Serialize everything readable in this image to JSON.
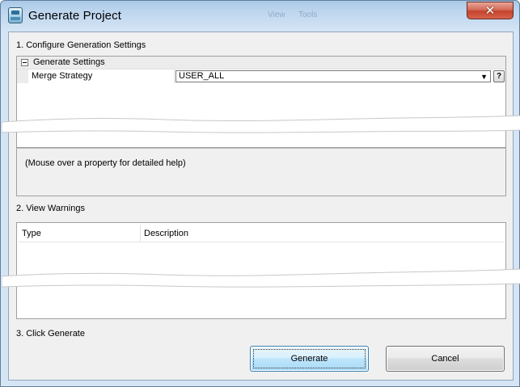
{
  "window": {
    "title": "Generate Project",
    "close_glyph": "✕",
    "background_menu_items": [
      "View",
      "Tools"
    ]
  },
  "settings": {
    "section_label": "1. Configure Generation Settings",
    "group": {
      "label": "Generate Settings",
      "collapse_icon": "minus-box-icon"
    },
    "properties": [
      {
        "name": "Merge Strategy",
        "value": "USER_ALL",
        "help_glyph": "?"
      }
    ],
    "help_text": "(Mouse over a property for detailed help)"
  },
  "warnings": {
    "section_label": "2. View Warnings",
    "columns": [
      "Type",
      "Description"
    ],
    "rows": []
  },
  "actions": {
    "section_label": "3. Click Generate",
    "generate_label": "Generate",
    "cancel_label": "Cancel"
  },
  "colors": {
    "titlebar": "#bcd5ee",
    "close_button": "#c4432c",
    "dialog_body": "#f0f0f0",
    "primary_button": "#bee6fd",
    "panel_border": "#a0a0a0"
  }
}
